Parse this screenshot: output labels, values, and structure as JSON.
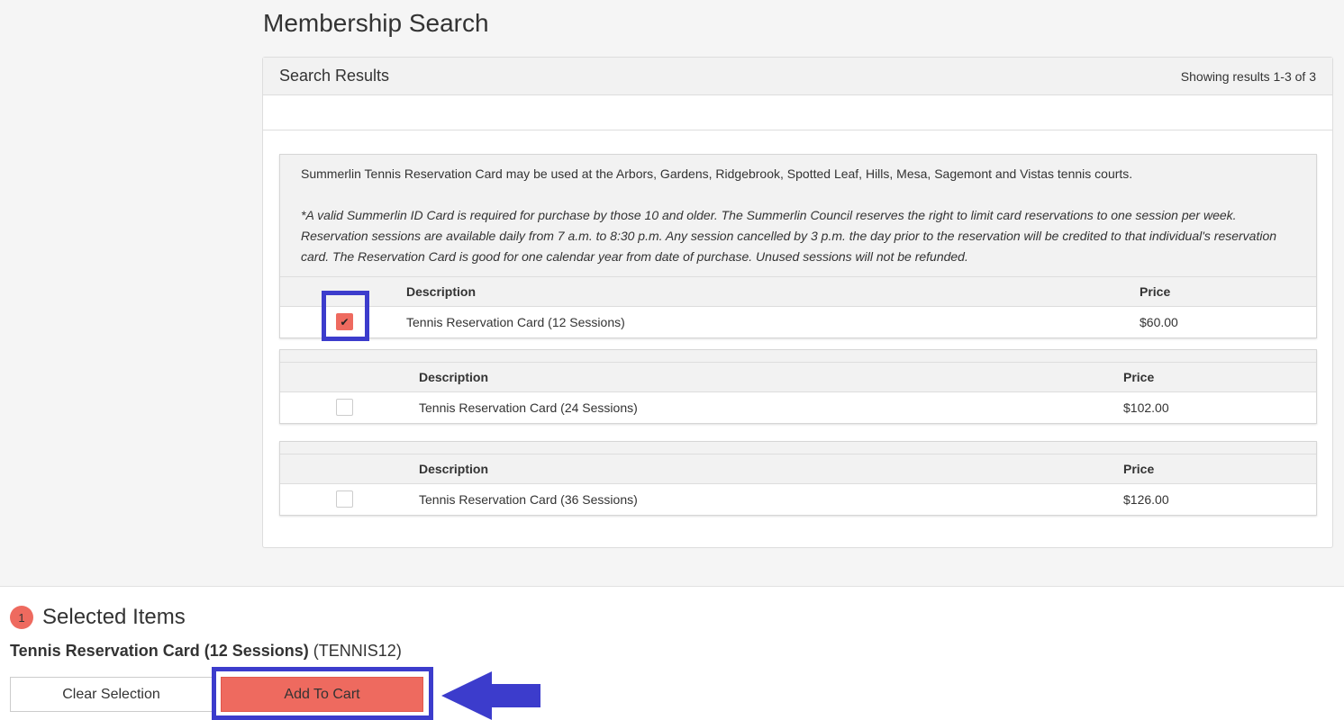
{
  "page": {
    "title": "Membership Search"
  },
  "results": {
    "title": "Search Results",
    "count_text": "Showing results 1-3 of 3"
  },
  "groups": [
    {
      "info": "Summerlin Tennis Reservation Card may be used at the Arbors, Gardens, Ridgebrook, Spotted Leaf, Hills, Mesa, Sagemont and Vistas tennis courts.",
      "note": "*A valid Summerlin ID Card is required for purchase by those 10 and older. The Summerlin Council reserves the right to limit card reservations to one session per week. Reservation sessions are available daily from 7 a.m. to 8:30 p.m. Any session cancelled by 3 p.m. the day prior to the reservation will be credited to that individual's reservation card. The Reservation Card is good for one calendar year from date of purchase. Unused sessions will not be refunded.",
      "header_description": "Description",
      "header_price": "Price",
      "item_description": "Tennis Reservation Card (12 Sessions)",
      "item_price": "$60.00",
      "checked": true
    },
    {
      "header_description": "Description",
      "header_price": "Price",
      "item_description": "Tennis Reservation Card (24 Sessions)",
      "item_price": "$102.00",
      "checked": false
    },
    {
      "header_description": "Description",
      "header_price": "Price",
      "item_description": "Tennis Reservation Card (36 Sessions)",
      "item_price": "$126.00",
      "checked": false
    }
  ],
  "selected": {
    "count": "1",
    "title": "Selected Items",
    "item_name": "Tennis Reservation Card (12 Sessions)",
    "item_code": "(TENNIS12)"
  },
  "buttons": {
    "clear_label": "Clear Selection",
    "add_label": "Add To Cart"
  },
  "icons": {
    "checkmark": "check-icon",
    "arrow": "arrow-left-icon"
  },
  "colors": {
    "accent": "#ee6a5f",
    "highlight": "#3c3ccc"
  }
}
